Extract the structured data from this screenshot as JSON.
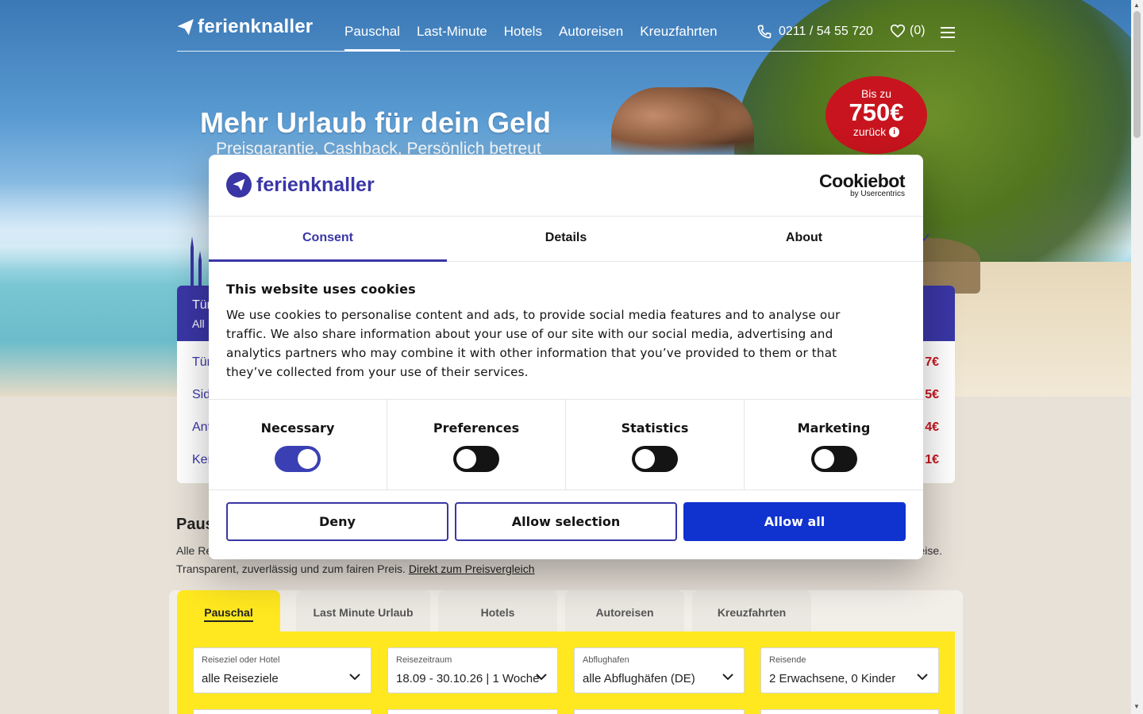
{
  "header": {
    "logo": "ferienknaller",
    "nav": [
      "Pauschal",
      "Last-Minute",
      "Hotels",
      "Autoreisen",
      "Kreuzfahrten"
    ],
    "phone": "0211 / 54 55 720",
    "favorites": "(0)"
  },
  "hero": {
    "headline": "Mehr Urlaub für dein Geld",
    "subline": "Preisgarantie, Cashback, Persönlich betreut",
    "badge": {
      "top": "Bis zu",
      "amount": "750€",
      "bottom": "zurück",
      "info": "i"
    }
  },
  "deals": {
    "head_title": "Tür",
    "head_sub": "All",
    "rows": [
      "Tür",
      "Sid",
      "Ant",
      "Ker"
    ],
    "prices": [
      "7€",
      "5€",
      "4€",
      "1€"
    ]
  },
  "section": {
    "title": "Paus",
    "text_start": "Alle Re",
    "text_end": "eise.",
    "line2": "Transparent, zuverlässig und zum fairen Preis.",
    "link": "Direkt zum Preisvergleich"
  },
  "search_tabs": [
    "Pauschal",
    "Last Minute Urlaub",
    "Hotels",
    "Autoreisen",
    "Kreuzfahrten"
  ],
  "search_fields": [
    {
      "label": "Reiseziel oder Hotel",
      "value": "alle Reiseziele"
    },
    {
      "label": "Reisezeitraum",
      "value": "18.09 - 30.10.26 | 1 Woche"
    },
    {
      "label": "Abflughafen",
      "value": "alle Abflughäfen (DE)"
    },
    {
      "label": "Reisende",
      "value": "2 Erwachsene, 0 Kinder"
    }
  ],
  "modal": {
    "logo": "ferienknaller",
    "provider": "Cookiebot",
    "provider_sub": "by Usercentrics",
    "tabs": [
      "Consent",
      "Details",
      "About"
    ],
    "heading": "This website uses cookies",
    "body": "We use cookies to personalise content and ads, to provide social media features and to analyse our traffic. We also share information about your use of our site with our social media, advertising and analytics partners who may combine it with other information that you’ve provided to them or that they’ve collected from your use of their services.",
    "toggles": [
      {
        "label": "Necessary",
        "on": true
      },
      {
        "label": "Preferences",
        "on": false
      },
      {
        "label": "Statistics",
        "on": false
      },
      {
        "label": "Marketing",
        "on": false
      }
    ],
    "buttons": {
      "deny": "Deny",
      "selection": "Allow selection",
      "all": "Allow all"
    }
  },
  "colors": {
    "brand": "#3a36a6",
    "accent": "#ffe81f",
    "primary_button": "#1032cf",
    "badge": "#c8141e"
  }
}
